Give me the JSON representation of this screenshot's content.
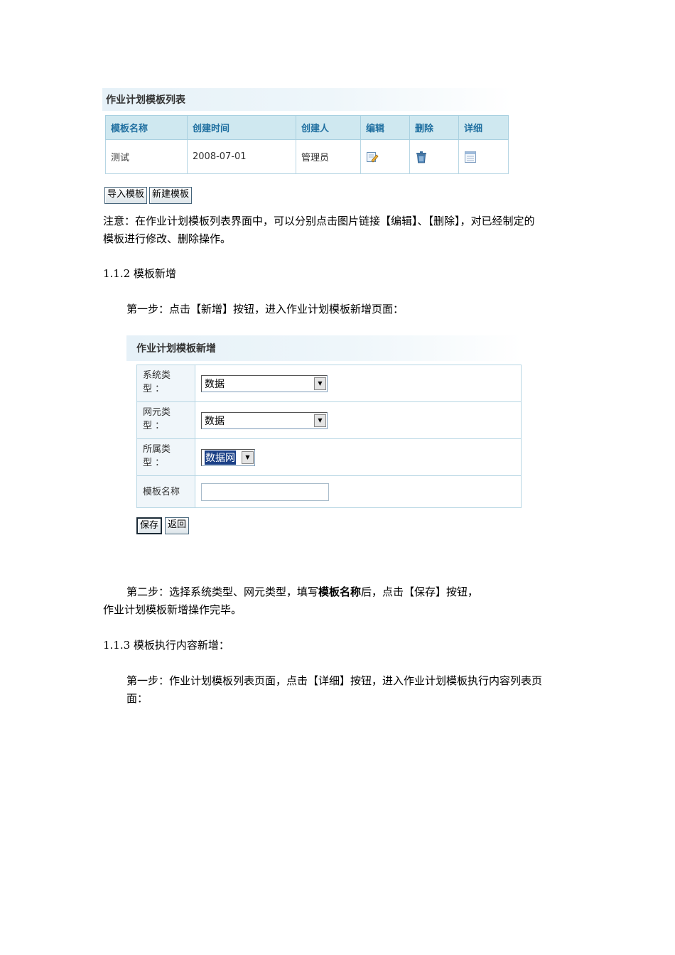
{
  "template_list": {
    "title": "作业计划模板列表",
    "columns": [
      "模板名称",
      "创建时间",
      "创建人",
      "编辑",
      "删除",
      "详细"
    ],
    "rows": [
      {
        "name": "测试",
        "created": "2008-07-01",
        "creator": "管理员",
        "edit_icon": "edit-icon",
        "delete_icon": "trash-icon",
        "detail_icon": "detail-icon"
      }
    ],
    "buttons": {
      "import": "导入模板",
      "create": "新建模板"
    }
  },
  "notes": {
    "list_note_line1": "注意：在作业计划模板列表界面中，可以分别点击图片链接【编辑】、【删除】，对已经制定的",
    "list_note_line2": "模板进行修改、删除操作。",
    "section_112": "1.1.2 模板新增",
    "step1_add": "第一步：点击【新增】按钮，进入作业计划模板新增页面：",
    "step2_pre": "第二步：选择系统类型、网元类型，填写",
    "step2_bold": "模板名称",
    "step2_post": "后，点击【保存】按钮，",
    "step2_line2": "作业计划模板新增操作完毕。",
    "section_113": "1.1.3 模板执行内容新增：",
    "step1_exec_line1": "第一步：作业计划模板列表页面，点击【详细】按钮，进入作业计划模板执行内容列表页",
    "step1_exec_line2": "面："
  },
  "template_form": {
    "title": "作业计划模板新增",
    "fields": [
      {
        "label_line1": "系统类",
        "label_line2": "型 ：",
        "value": "数据"
      },
      {
        "label_line1": "网元类",
        "label_line2": "型 ：",
        "value": "数据"
      },
      {
        "label_line1": "所属类",
        "label_line2": "型 ：",
        "value": "数据网"
      },
      {
        "label": "模板名称",
        "value": ""
      }
    ],
    "buttons": {
      "save": "保存",
      "back": "返回"
    }
  },
  "colors": {
    "header_bg": "#cfe8f0",
    "header_text": "#1f6fa0",
    "border": "#b7d6e4",
    "selected_option": "#1a3f86"
  }
}
